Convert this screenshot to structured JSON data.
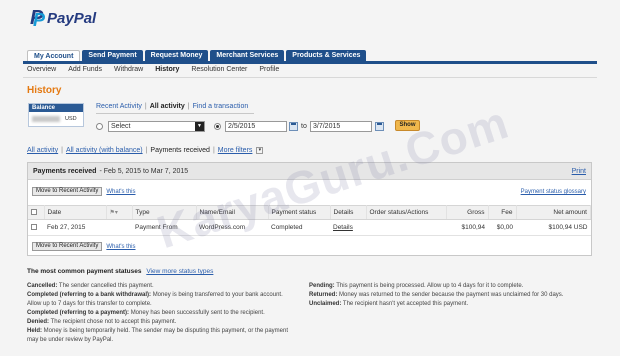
{
  "brand": {
    "logo_text": "PayPal",
    "logo_mark": "P"
  },
  "tabs": [
    {
      "label": "My Account",
      "active": true
    },
    {
      "label": "Send Payment",
      "active": false
    },
    {
      "label": "Request Money",
      "active": false
    },
    {
      "label": "Merchant Services",
      "active": false
    },
    {
      "label": "Products & Services",
      "active": false
    }
  ],
  "subnav": [
    {
      "label": "Overview",
      "active": false
    },
    {
      "label": "Add Funds",
      "active": false
    },
    {
      "label": "Withdraw",
      "active": false
    },
    {
      "label": "History",
      "active": true
    },
    {
      "label": "Resolution Center",
      "active": false
    },
    {
      "label": "Profile",
      "active": false
    }
  ],
  "page_title": "History",
  "balance": {
    "header": "Balance",
    "currency": "USD"
  },
  "view_links": {
    "recent": "Recent Activity",
    "all": "All activity",
    "find": "Find a transaction"
  },
  "search": {
    "select_value": "Select",
    "date_from": "2/5/2015",
    "to_label": "to",
    "date_to": "3/7/2015",
    "show_button": "Show"
  },
  "filters": {
    "all_activity": "All activity",
    "all_with_balance": "All activity (with balance)",
    "payments_received": "Payments received",
    "more_filters": "More filters"
  },
  "panel": {
    "title": "Payments received",
    "range": "- Feb 5, 2015 to Mar 7, 2015",
    "print": "Print",
    "move_button": "Move to Recent Activity",
    "whats_this": "What's this",
    "glossary": "Payment status glossary"
  },
  "table": {
    "headers": [
      "Date",
      "Type",
      "Name/Email",
      "Payment status",
      "Details",
      "Order status/Actions",
      "Gross",
      "Fee",
      "Net amount"
    ],
    "rows": [
      {
        "date": "Feb 27, 2015",
        "type": "Payment From",
        "name": "WordPress.com",
        "status": "Completed",
        "details": "Details",
        "order": "",
        "gross": "$100,94",
        "fee": "$0,00",
        "net": "$100,94 USD"
      }
    ]
  },
  "legend": {
    "title": "The most common payment statuses",
    "link": "View more status types",
    "left": [
      {
        "term": "Cancelled:",
        "desc": "The sender cancelled this payment."
      },
      {
        "term": "Completed (referring to a bank withdrawal):",
        "desc": "Money is being transferred to your bank account. Allow up to 7 days for this transfer to complete."
      },
      {
        "term": "Completed (referring to a payment):",
        "desc": "Money has been successfully sent to the recipient."
      },
      {
        "term": "Denied:",
        "desc": "The recipient chose not to accept this payment."
      },
      {
        "term": "Held:",
        "desc": "Money is being temporarily held. The sender may be disputing this payment, or the payment may be under review by PayPal."
      }
    ],
    "right": [
      {
        "term": "Pending:",
        "desc": "This payment is being processed. Allow up to 4 days for it to complete."
      },
      {
        "term": "Returned:",
        "desc": "Money was returned to the sender because the payment was unclaimed for 30 days."
      },
      {
        "term": "Unclaimed:",
        "desc": "The recipient hasn't yet accepted this payment."
      }
    ]
  },
  "watermark": "KaryaGuru.Com",
  "colors": {
    "brand_dark": "#253b80",
    "brand_light": "#179bd7",
    "nav": "#1f4f8a",
    "accent": "#e47911",
    "link": "#2a5dab"
  }
}
